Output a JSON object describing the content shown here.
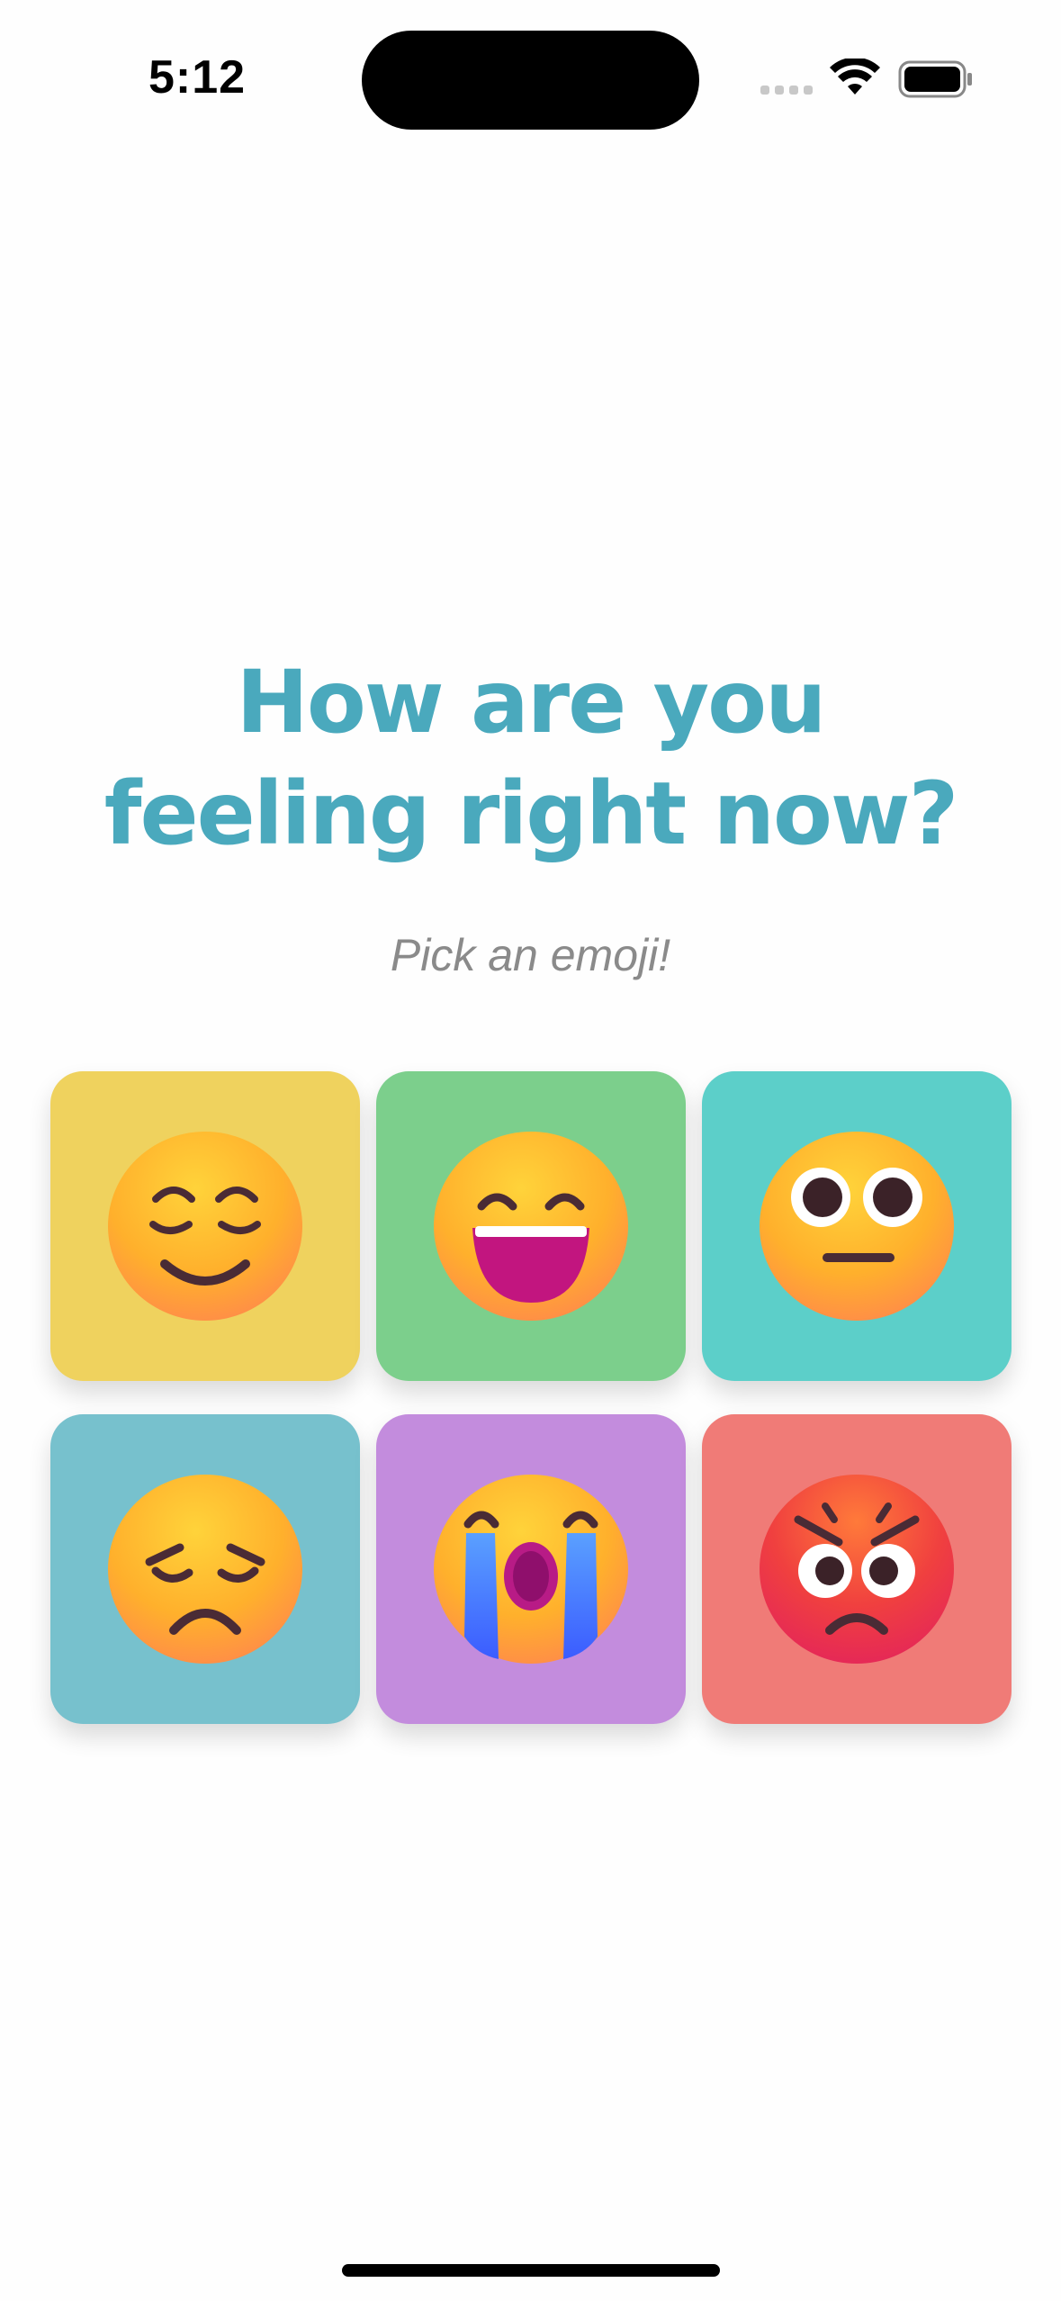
{
  "status_bar": {
    "time": "5:12",
    "icons": [
      "signal-icon",
      "wifi-icon",
      "battery-icon"
    ]
  },
  "prompt": {
    "title_line1": "How are you",
    "title_line2": "feeling right now?",
    "subtitle": "Pick an emoji!"
  },
  "moods": [
    {
      "name": "relieved",
      "color": "#efd25e"
    },
    {
      "name": "grinning",
      "color": "#7ccf8c"
    },
    {
      "name": "neutral",
      "color": "#5ccfc9"
    },
    {
      "name": "sad",
      "color": "#77c1cd"
    },
    {
      "name": "crying",
      "color": "#c38cdd"
    },
    {
      "name": "angry",
      "color": "#f07b77"
    }
  ],
  "colors": {
    "title": "#4aa9bd",
    "subtitle": "#8a8a8a"
  }
}
